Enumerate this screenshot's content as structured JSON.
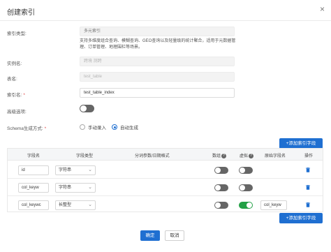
{
  "header": {
    "title": "创建索引",
    "close": "×"
  },
  "form": {
    "index_type": {
      "label": "索引类型:",
      "placeholder": "多元索引"
    },
    "index_type_note": "支持多维度组合查询、模糊查询、GEO查询以及轻量级的统计聚合，适用于元数据管理、订单管理、地理围栏等场景。",
    "instance_name": {
      "label": "实例名:",
      "value": "跨境 测跨"
    },
    "table_name": {
      "label": "表名:",
      "value": "test_table"
    },
    "index_name": {
      "label": "索引名:",
      "required": "*",
      "value": "test_table_index"
    },
    "advanced": {
      "label": "高级选项:"
    },
    "schema_mode": {
      "label": "Schema生成方式:",
      "required": "*",
      "options": [
        {
          "label": "手动录入",
          "checked": false
        },
        {
          "label": "自动生成",
          "checked": true
        }
      ]
    }
  },
  "add_field_button": "+添加索引字段",
  "table": {
    "headers": {
      "field_name": "字段名",
      "field_type": "字段类型",
      "tokenizer": "分词参数/日期格式",
      "array": "数组",
      "virtual": "虚拟",
      "source_field": "原始字段名",
      "action": "操作"
    },
    "help_icon": "?",
    "rows": [
      {
        "name": "id",
        "type": "字符串",
        "array": false,
        "virtual": false,
        "source": ""
      },
      {
        "name": "col_keyw",
        "type": "字符串",
        "array": false,
        "virtual": false,
        "source": ""
      },
      {
        "name": "col_keywc",
        "type": "长整型",
        "array": false,
        "virtual": true,
        "source": "col_keyw"
      }
    ]
  },
  "footer": {
    "confirm": "确定",
    "cancel": "取消"
  },
  "colors": {
    "primary": "#1f6fd1",
    "toggle_on": "#22a045",
    "toggle_off": "#666666",
    "danger": "#e04b4b"
  }
}
